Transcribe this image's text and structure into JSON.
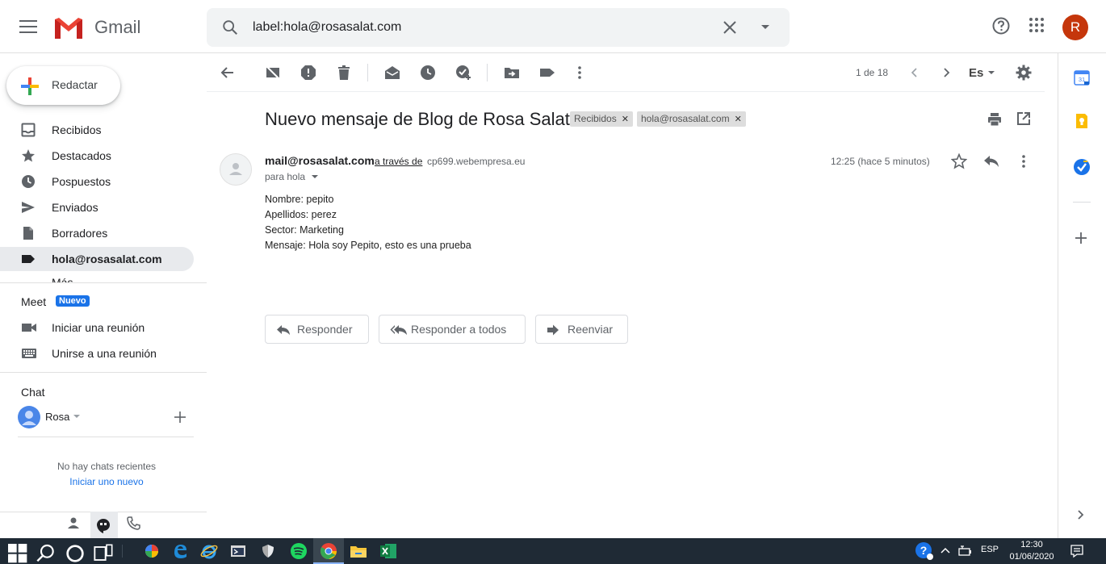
{
  "app": {
    "name": "Gmail"
  },
  "search": {
    "query": "label:hola@rosasalat.com"
  },
  "account": {
    "avatar_letter": "R",
    "color": "#c5360b"
  },
  "compose": {
    "label": "Redactar"
  },
  "nav": {
    "items": [
      {
        "label": "Recibidos",
        "icon": "inbox-icon"
      },
      {
        "label": "Destacados",
        "icon": "star-icon"
      },
      {
        "label": "Pospuestos",
        "icon": "clock-icon"
      },
      {
        "label": "Enviados",
        "icon": "send-icon"
      },
      {
        "label": "Borradores",
        "icon": "draft-icon"
      },
      {
        "label": "hola@rosasalat.com",
        "icon": "label-icon",
        "active": true
      }
    ],
    "more_cut": "Más"
  },
  "meet": {
    "title": "Meet",
    "badge": "Nuevo",
    "items": [
      {
        "label": "Iniciar una reunión",
        "icon": "video-icon"
      },
      {
        "label": "Unirse a una reunión",
        "icon": "keyboard-icon"
      }
    ]
  },
  "chat": {
    "title": "Chat",
    "user": "Rosa",
    "empty": "No hay chats recientes",
    "start_link": "Iniciar uno nuevo"
  },
  "toolbar": {
    "pager": "1 de 18",
    "language": "Es"
  },
  "message": {
    "subject": "Nuevo mensaje de Blog de Rosa Salat",
    "labels": [
      "Recibidos",
      "hola@rosasalat.com"
    ],
    "from": "mail@rosasalat.com",
    "via_text": "a través de",
    "via_server": "cp699.webempresa.eu",
    "to": "para hola",
    "time": "12:25 (hace 5 minutos)",
    "body": [
      "Nombre: pepito",
      "Apellidos: perez",
      "Sector: Marketing",
      "Mensaje: Hola soy Pepito, esto es una prueba"
    ]
  },
  "actions": {
    "reply": "Responder",
    "reply_all": "Responder a todos",
    "forward": "Reenviar"
  },
  "taskbar": {
    "language": "ESP",
    "time": "12:30",
    "date": "01/06/2020"
  }
}
